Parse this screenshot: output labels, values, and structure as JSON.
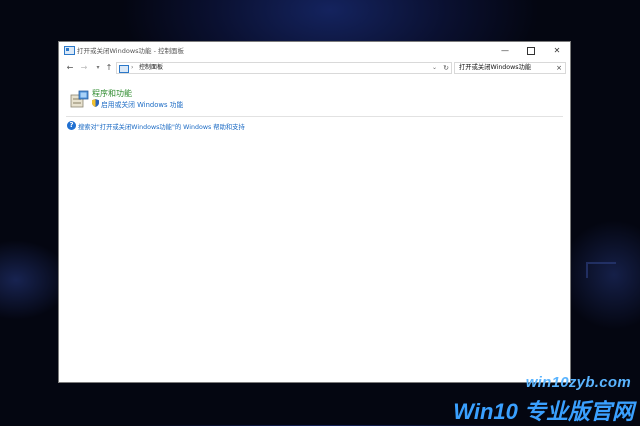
{
  "window": {
    "title": "打开或关闭Windows功能 - 控制面板",
    "min_glyph": "—",
    "close_glyph": "✕"
  },
  "nav": {
    "back": "←",
    "forward": "→",
    "recent": "▾",
    "up": "↑"
  },
  "address": {
    "chevron": "›",
    "path": "控制面板",
    "dropdown": "⌄",
    "refresh": "↻"
  },
  "search": {
    "value": "打开或关闭Windows功能",
    "clear": "×"
  },
  "result": {
    "icon": "programs-icon",
    "title": "程序和功能",
    "link": "启用或关闭 Windows 功能"
  },
  "help": {
    "icon": "help-icon",
    "glyph": "?",
    "text": "搜索对\"打开或关闭Windows功能\"的 Windows 帮助和支持"
  },
  "watermark": {
    "url": "win10zyb.com",
    "brand": "Win10 专业版官网"
  },
  "colors": {
    "link": "#1a6ac4",
    "result_title": "#2e8b2e",
    "watermark": "#3aa0ff"
  }
}
